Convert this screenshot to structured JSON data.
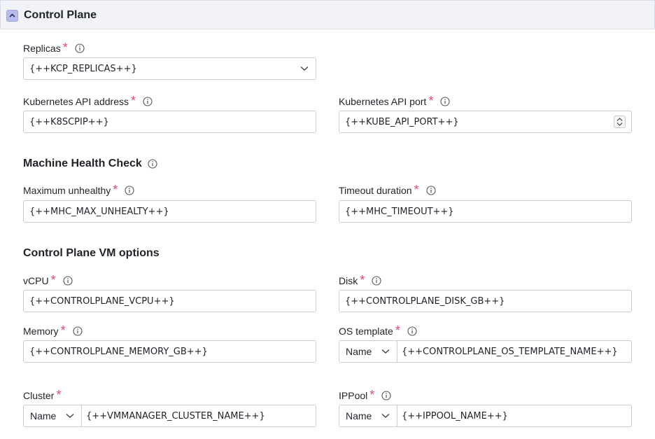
{
  "section": {
    "title": "Control Plane"
  },
  "replicas": {
    "label": "Replicas",
    "value": "{++KCP_REPLICAS++}"
  },
  "api_address": {
    "label": "Kubernetes API address",
    "value": "{++K8SCPIP++}"
  },
  "api_port": {
    "label": "Kubernetes API port",
    "value": "{++KUBE_API_PORT++}"
  },
  "mhc": {
    "heading": "Machine Health Check",
    "max_unhealthy": {
      "label": "Maximum unhealthy",
      "value": "{++MHC_MAX_UNHEALTY++}"
    },
    "timeout": {
      "label": "Timeout duration",
      "value": "{++MHC_TIMEOUT++}"
    }
  },
  "vm": {
    "heading": "Control Plane VM options",
    "vcpu": {
      "label": "vCPU",
      "value": "{++CONTROLPLANE_VCPU++}"
    },
    "disk": {
      "label": "Disk",
      "value": "{++CONTROLPLANE_DISK_GB++}"
    },
    "memory": {
      "label": "Memory",
      "value": "{++CONTROLPLANE_MEMORY_GB++}"
    },
    "os_template": {
      "label": "OS template",
      "select": "Name",
      "value": "{++CONTROLPLANE_OS_TEMPLATE_NAME++}"
    },
    "cluster": {
      "label": "Cluster",
      "select": "Name",
      "value": "{++VMMANAGER_CLUSTER_NAME++}"
    },
    "ippool": {
      "label": "IPPool",
      "select": "Name",
      "value": "{++IPPOOL_NAME++}"
    }
  },
  "required_mark": "*",
  "icons": {
    "collapse": "chevron-up-icon",
    "info": "info-icon",
    "dropdown": "chevron-down-icon",
    "stepper": "stepper-icon"
  },
  "colors": {
    "required": "#e0457b",
    "collapse_button": "#b7bcf0",
    "header_bg": "#f2f3f8"
  }
}
